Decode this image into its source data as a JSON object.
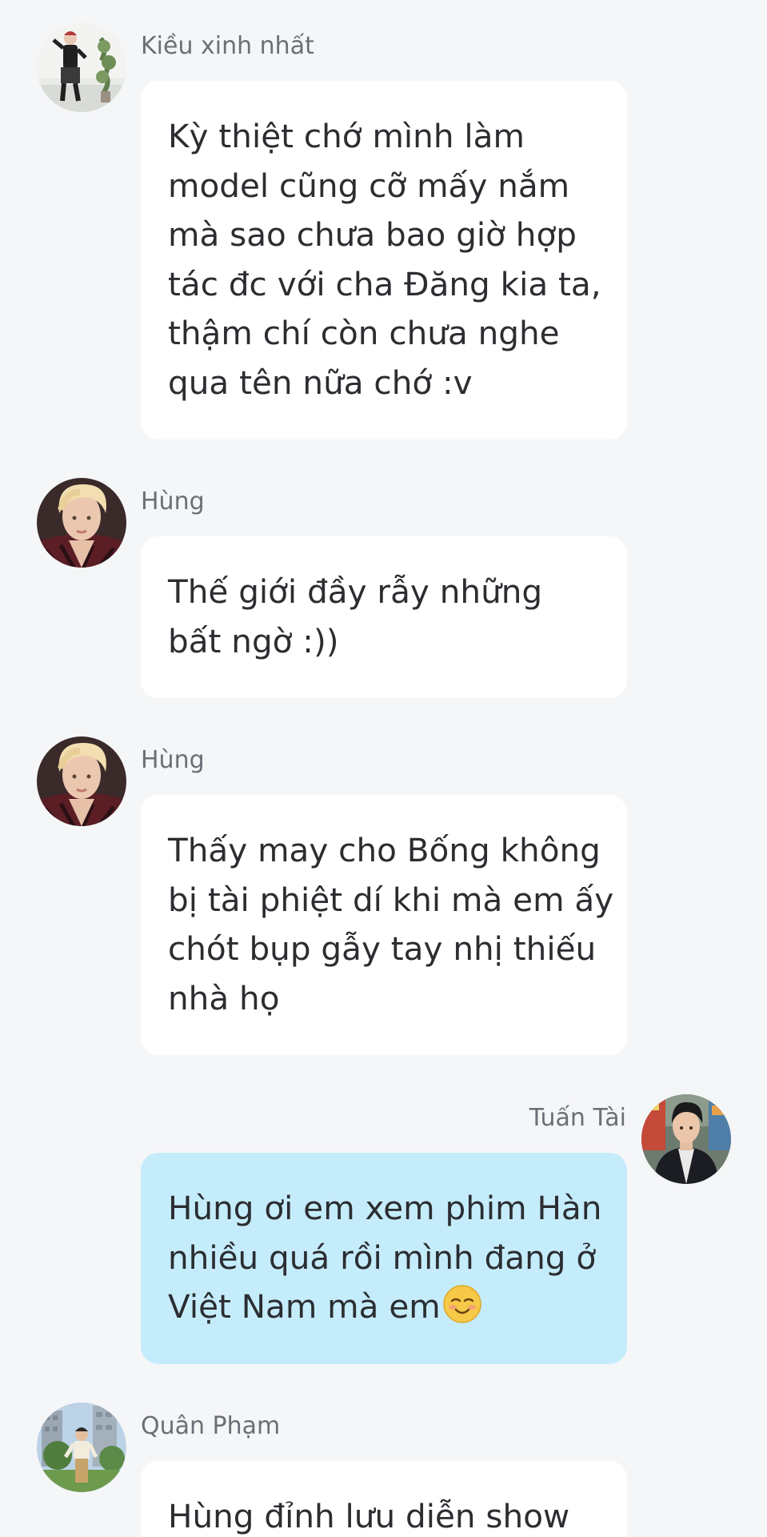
{
  "messages": [
    {
      "sender": "Kiều xinh nhất",
      "side": "left",
      "avatar_icon": "profile-photo-woman-standing",
      "lines": [
        "Kỳ thiệt chớ mình làm",
        "model cũng cỡ mấy nắm",
        "mà sao chưa bao giờ hợp",
        "tác đc với cha Đăng kia ta,",
        "thậm chí còn chưa nghe",
        "qua tên nữa chớ :v"
      ]
    },
    {
      "sender": "Hùng",
      "side": "left",
      "avatar_icon": "profile-photo-blond-man",
      "lines": [
        "Thế giới đầy rẫy những",
        "bất ngờ :))"
      ]
    },
    {
      "sender": "Hùng",
      "side": "left",
      "avatar_icon": "profile-photo-blond-man",
      "lines": [
        "Thấy may cho Bống không",
        "bị tài phiệt dí khi mà em ấy",
        "chót bụp gẫy tay nhị thiếu",
        "nhà họ"
      ]
    },
    {
      "sender": "Tuấn Tài",
      "side": "right",
      "avatar_icon": "profile-photo-man-dark-jacket",
      "lines": [
        "Hùng ơi em xem phim Hàn",
        "nhiều quá rồi mình đang ở",
        "Việt Nam mà em"
      ],
      "trailing_emoji": "smiling-face-emoji"
    },
    {
      "sender": "Quân Phạm",
      "side": "left",
      "avatar_icon": "profile-photo-man-outdoors",
      "lines": [
        "Hùng đỉnh lưu diễn show"
      ]
    }
  ],
  "colors": {
    "background": "#f5f6f8",
    "bubble_other": "#ffffff",
    "bubble_mine": "#c5ecfb",
    "sender_name": "#6b6f76",
    "message_text": "#2b2d31"
  }
}
